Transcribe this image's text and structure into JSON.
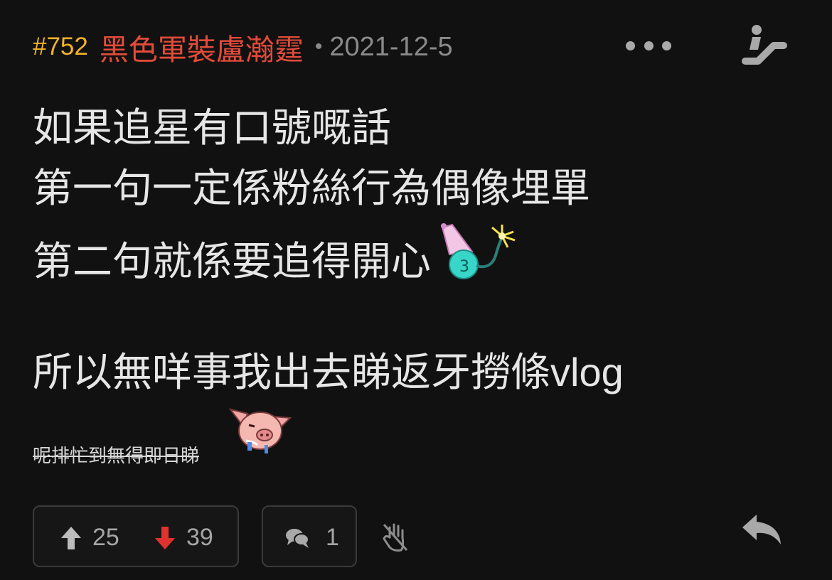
{
  "header": {
    "post_number": "#752",
    "username": "黑色軍裝盧瀚霆",
    "separator": "•",
    "date": "2021-12-5"
  },
  "colors": {
    "post_number": "#f2b32c",
    "username": "#e34b3a",
    "meta": "#8a8a8a",
    "text": "#e6e6e6",
    "upvote": "#bcbcbc",
    "downvote": "#e0332f",
    "background": "#111111"
  },
  "content": {
    "lines": [
      "如果追星有口號嘅話",
      "第一句一定係粉絲行為偶像埋單",
      "第二句就係要追得開心",
      "所以無咩事我出去睇返牙撈條vlog"
    ],
    "small_strikethrough": "呢排忙到無得即日睇"
  },
  "emojis": [
    "party-bomb-emoji",
    "drooling-pig-emoji"
  ],
  "footer": {
    "upvotes": "25",
    "downvotes": "39",
    "comments": "1"
  },
  "icons": [
    "more-icon",
    "escalator-icon",
    "upvote-arrow-icon",
    "downvote-arrow-icon",
    "comment-icon",
    "hand-icon",
    "reply-icon"
  ]
}
